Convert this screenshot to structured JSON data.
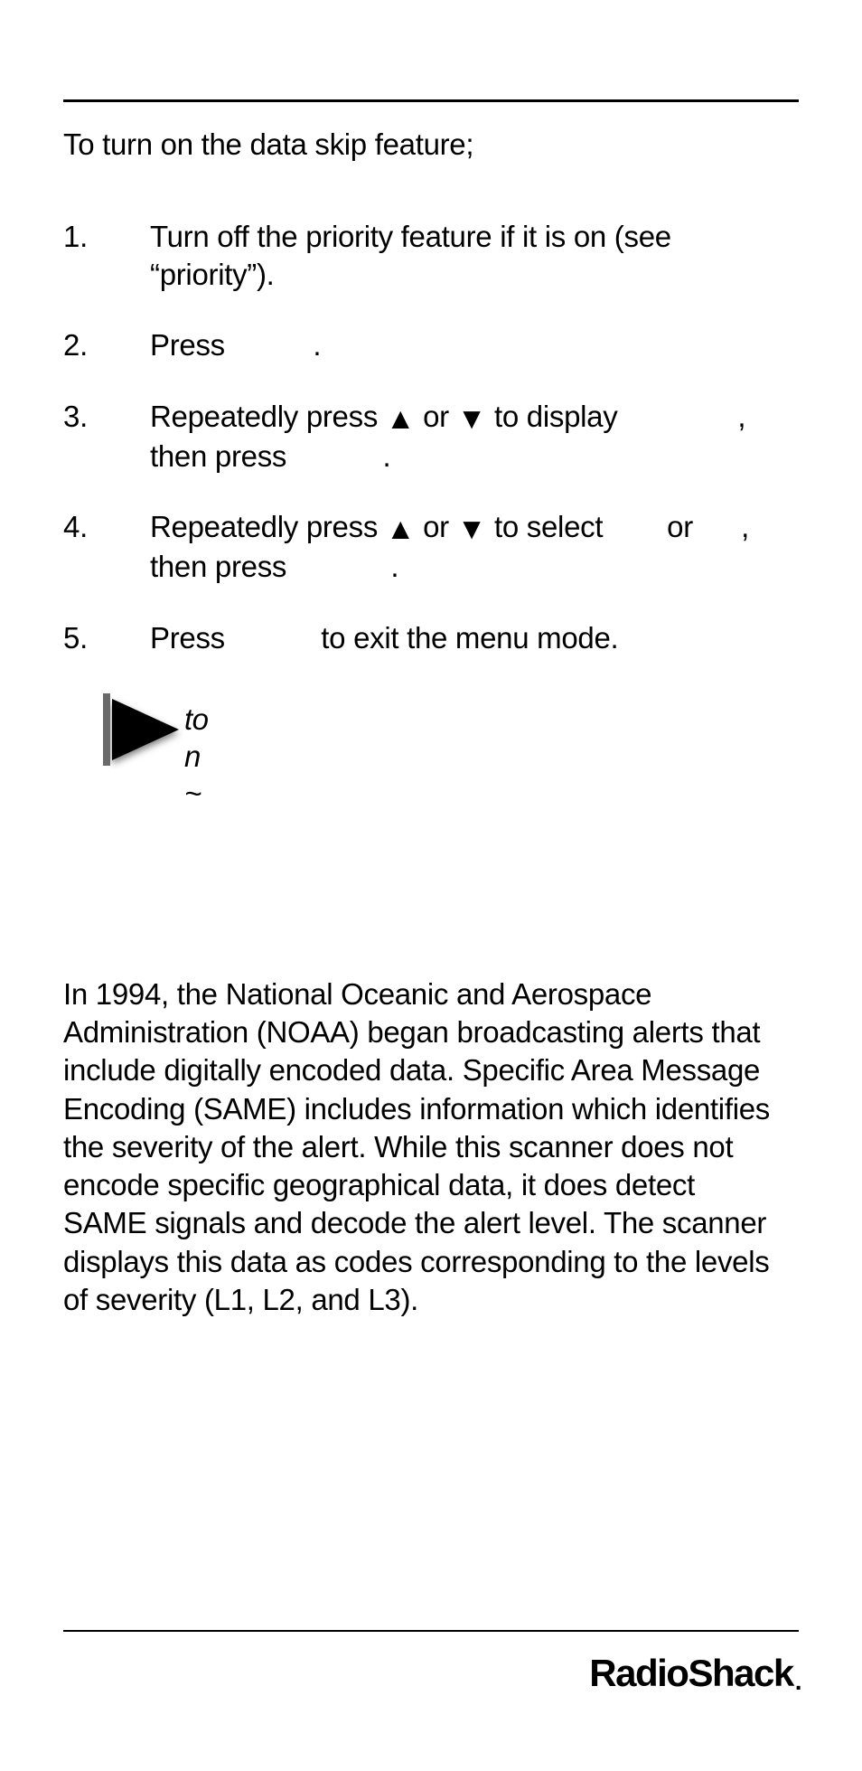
{
  "hr_top": true,
  "intro": "To turn on the data skip feature;",
  "steps": [
    {
      "html": "Turn off the priority feature if it is on (see “priority”)."
    },
    {
      "html": "Press&nbsp;&nbsp;&nbsp;&nbsp;&nbsp;&nbsp;&nbsp;&nbsp;&nbsp;&nbsp;&nbsp;."
    },
    {
      "html": "Repeatedly press <span class='up'>▲</span> or <span class='down'>▼</span> to display&nbsp;&nbsp;&nbsp;&nbsp;&nbsp;&nbsp;&nbsp;&nbsp;&nbsp;&nbsp;&nbsp;&nbsp;&nbsp;&nbsp;&nbsp;, then press&nbsp;&nbsp;&nbsp;&nbsp;&nbsp;&nbsp;&nbsp;&nbsp;&nbsp;&nbsp;&nbsp;&nbsp;."
    },
    {
      "html": "Repeatedly press <span class='up'>▲</span> or <span class='down'>▼</span> to select&nbsp;&nbsp;&nbsp;&nbsp;&nbsp;&nbsp;&nbsp; or&nbsp;&nbsp;&nbsp;&nbsp;&nbsp;&nbsp;, then press&nbsp;&nbsp;&nbsp;&nbsp;&nbsp;&nbsp;&nbsp;&nbsp;&nbsp;&nbsp;&nbsp;&nbsp;&nbsp;."
    },
    {
      "html": "Press&nbsp;&nbsp;&nbsp;&nbsp;&nbsp;&nbsp;&nbsp;&nbsp;&nbsp;&nbsp;&nbsp;&nbsp;to exit the menu mode."
    }
  ],
  "fragment_lines": "to\nn\n~",
  "section_body": "In 1994, the National Oceanic and Aerospace Administration (NOAA) began broadcasting alerts that include digitally encoded data. Specific Area Message Encoding (SAME) includes information which identifies the severity of the alert. While this scanner does not encode specific geographical data, it does detect SAME signals and decode the alert level. The scanner displays this data as codes corresponding to the levels of severity (L1, L2, and L3).",
  "brand": "RadioShack"
}
